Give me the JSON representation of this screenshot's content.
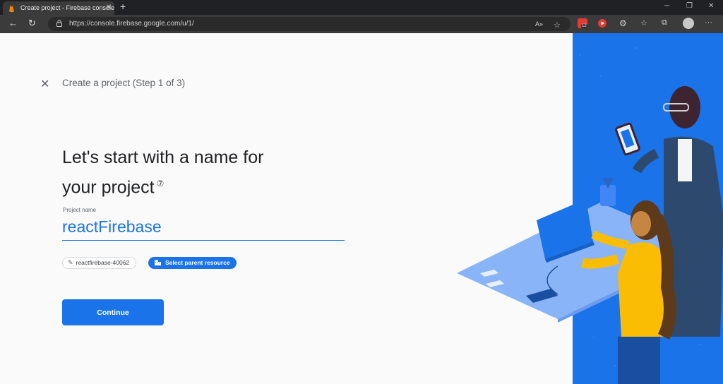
{
  "browser": {
    "tab_title": "Create project - Firebase console",
    "tab_close": "✕",
    "new_tab": "+",
    "url": "https://console.firebase.google.com/u/1/",
    "ext_badge": "12",
    "win_minimize": "─",
    "win_restore": "❐",
    "win_close": "✕"
  },
  "wizard": {
    "close": "✕",
    "step_title": "Create a project (Step 1 of 3)",
    "headline": "Let's start with a name for your project",
    "help": "⑦",
    "field_label": "Project name",
    "project_name": "reactFirebase",
    "project_id": "reactfirebase-40062",
    "parent_button": "Select parent resource",
    "continue_button": "Continue"
  },
  "colors": {
    "accent": "#1a73e8",
    "panel": "#1a73e8",
    "desk": "#8ab4f8",
    "shirt": "#fbbc04"
  }
}
